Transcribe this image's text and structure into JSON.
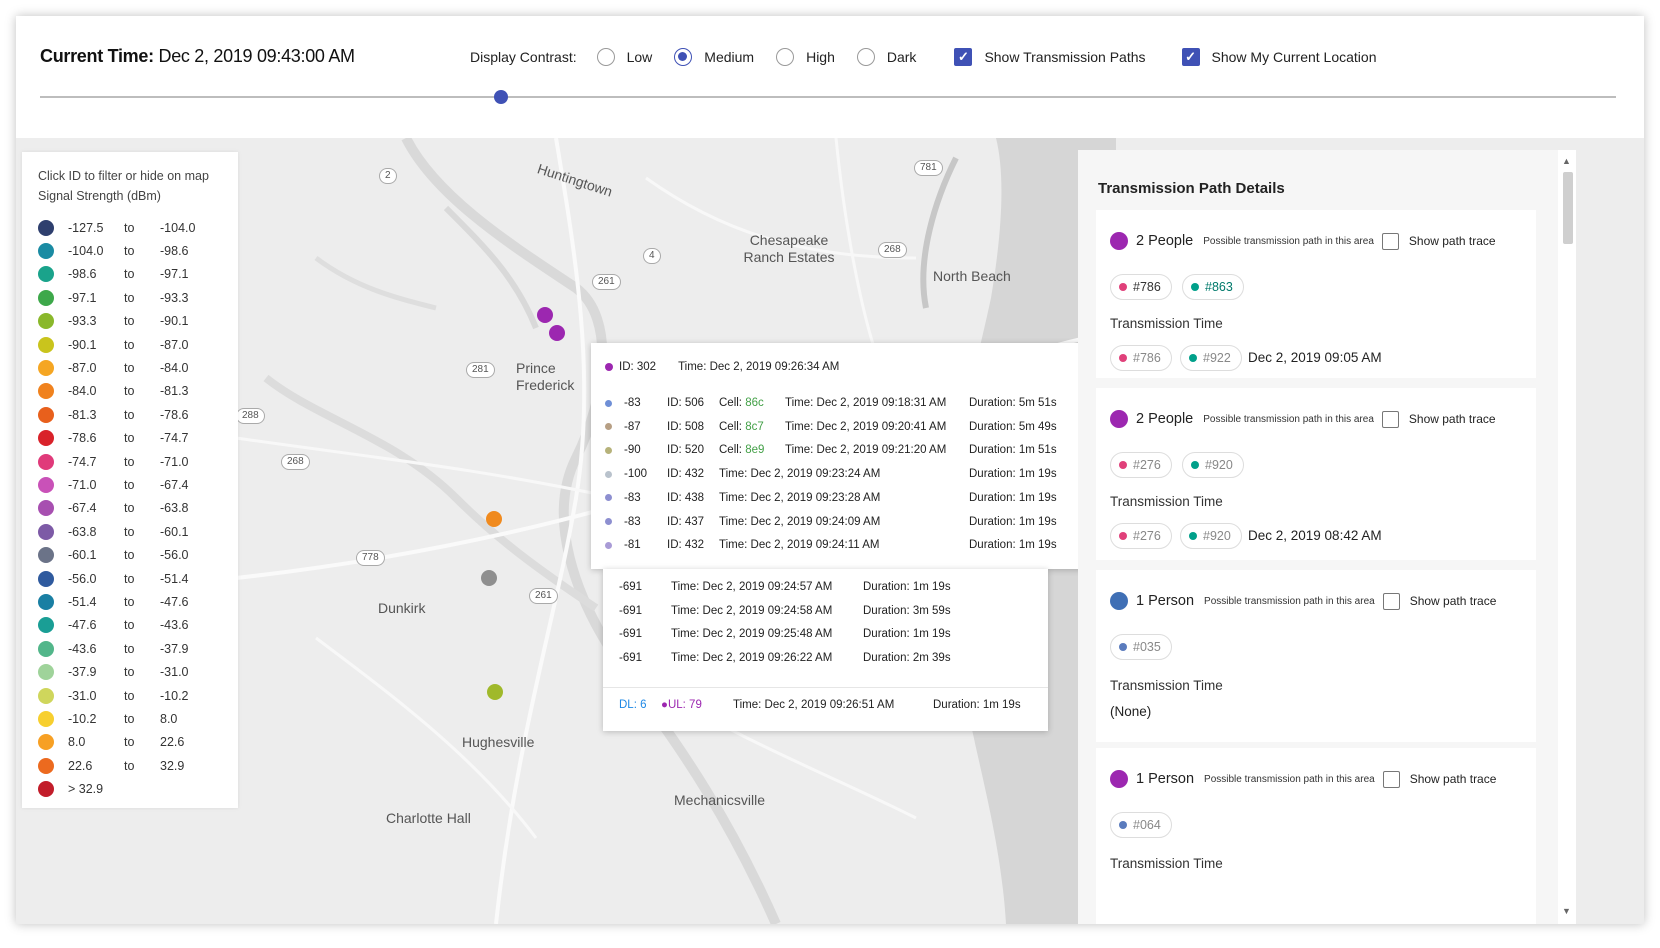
{
  "header": {
    "current_time_label": "Current Time:",
    "current_time_value": "Dec 2, 2019 09:43:00 AM",
    "contrast_label": "Display Contrast:",
    "contrast_options": [
      "Low",
      "Medium",
      "High",
      "Dark"
    ],
    "contrast_selected": "Medium",
    "show_paths_label": "Show Transmission Paths",
    "show_location_label": "Show My Current Location"
  },
  "map": {
    "places": [
      "Huntingtown",
      "Chesapeake Ranch Estates",
      "North Beach",
      "Prince Frederick",
      "Dunkirk",
      "Hughesville",
      "Charlotte Hall",
      "Mechanicsville"
    ],
    "shields": [
      "2",
      "781",
      "4",
      "268",
      "261",
      "281",
      "288",
      "268",
      "778",
      "261"
    ]
  },
  "legend": {
    "hint": "Click ID to filter or hide on map",
    "unit": "Signal Strength (dBm)",
    "to_word": "to",
    "rows": [
      {
        "from": "-127.5",
        "to": "-104.0",
        "color": "#2e3f6e"
      },
      {
        "from": "-104.0",
        "to": "-98.6",
        "color": "#1a8ba3"
      },
      {
        "from": "-98.6",
        "to": "-97.1",
        "color": "#1aa38b"
      },
      {
        "from": "-97.1",
        "to": "-93.3",
        "color": "#3da84a"
      },
      {
        "from": "-93.3",
        "to": "-90.1",
        "color": "#8ab82b"
      },
      {
        "from": "-90.1",
        "to": "-87.0",
        "color": "#c9c41d"
      },
      {
        "from": "-87.0",
        "to": "-84.0",
        "color": "#f5a623"
      },
      {
        "from": "-84.0",
        "to": "-81.3",
        "color": "#f0821e"
      },
      {
        "from": "-81.3",
        "to": "-78.6",
        "color": "#e8601c"
      },
      {
        "from": "-78.6",
        "to": "-74.7",
        "color": "#d9222a"
      },
      {
        "from": "-74.7",
        "to": "-71.0",
        "color": "#e03a7a"
      },
      {
        "from": "-71.0",
        "to": "-67.4",
        "color": "#c951b8"
      },
      {
        "from": "-67.4",
        "to": "-63.8",
        "color": "#a74fb0"
      },
      {
        "from": "-63.8",
        "to": "-60.1",
        "color": "#7d5aa6"
      },
      {
        "from": "-60.1",
        "to": "-56.0",
        "color": "#6b7388"
      },
      {
        "from": "-56.0",
        "to": "-51.4",
        "color": "#2f5a9e"
      },
      {
        "from": "-51.4",
        "to": "-47.6",
        "color": "#1a7fa3"
      },
      {
        "from": "-47.6",
        "to": "-43.6",
        "color": "#1a9e95"
      },
      {
        "from": "-43.6",
        "to": "-37.9",
        "color": "#52b68a"
      },
      {
        "from": "-37.9",
        "to": "-31.0",
        "color": "#9fd39a"
      },
      {
        "from": "-31.0",
        "to": "-10.2",
        "color": "#cfd65c"
      },
      {
        "from": "-10.2",
        "to": "8.0",
        "color": "#f7cf2f"
      },
      {
        "from": "8.0",
        "to": "22.6",
        "color": "#f7a024"
      },
      {
        "from": "22.6",
        "to": "32.9",
        "color": "#ec6a1f"
      },
      {
        "from": "> 32.9",
        "to": "",
        "color": "#c21d2a"
      }
    ]
  },
  "popup": {
    "header_id": "ID: 302",
    "header_time": "Time: Dec 2, 2019 09:26:34 AM",
    "rows": [
      {
        "dbm": "-83",
        "id": "ID: 506",
        "cell_label": "Cell:",
        "cell": "86c",
        "time": "Time: Dec 2, 2019 09:18:31 AM",
        "duration": "Duration: 5m 51s",
        "color": "#6f8fd6"
      },
      {
        "dbm": "-87",
        "id": "ID: 508",
        "cell_label": "Cell:",
        "cell": "8c7",
        "time": "Time: Dec 2, 2019 09:20:41 AM",
        "duration": "Duration: 5m 49s",
        "color": "#b79f84"
      },
      {
        "dbm": "-90",
        "id": "ID: 520",
        "cell_label": "Cell:",
        "cell": "8e9",
        "time": "Time: Dec 2, 2019 09:21:20 AM",
        "duration": "Duration: 1m 51s",
        "color": "#b6b27a"
      },
      {
        "dbm": "-100",
        "id": "ID: 432",
        "cell_label": "",
        "cell": "",
        "time": "Time: Dec 2, 2019 09:23:24 AM",
        "duration": "Duration: 1m 19s",
        "color": "#b9c2cc"
      },
      {
        "dbm": "-83",
        "id": "ID: 438",
        "cell_label": "",
        "cell": "",
        "time": "Time: Dec 2, 2019 09:23:28 AM",
        "duration": "Duration: 1m 19s",
        "color": "#8d8fd0"
      },
      {
        "dbm": "-83",
        "id": "ID: 437",
        "cell_label": "",
        "cell": "",
        "time": "Time: Dec 2, 2019 09:24:09 AM",
        "duration": "Duration: 1m 19s",
        "color": "#8d8fd0"
      },
      {
        "dbm": "-81",
        "id": "ID: 432",
        "cell_label": "",
        "cell": "",
        "time": "Time: Dec 2, 2019 09:24:11 AM",
        "duration": "Duration: 1m 19s",
        "color": "#a99bd6"
      }
    ],
    "rows2": [
      {
        "dbm": "-691",
        "time": "Time: Dec 2, 2019 09:24:57 AM",
        "duration": "Duration: 1m 19s"
      },
      {
        "dbm": "-691",
        "time": "Time: Dec 2, 2019 09:24:58 AM",
        "duration": "Duration: 3m 59s"
      },
      {
        "dbm": "-691",
        "time": "Time: Dec 2, 2019 09:25:48 AM",
        "duration": "Duration: 1m 19s"
      },
      {
        "dbm": "-691",
        "time": "Time: Dec 2, 2019 09:26:22 AM",
        "duration": "Duration: 2m 39s"
      }
    ],
    "footer": {
      "dl": "DL: 6",
      "ul": "UL: 79",
      "time": "Time: Dec 2, 2019 09:26:51 AM",
      "duration": "Duration: 1m 19s"
    }
  },
  "panel": {
    "title": "Transmission Path Details",
    "desc": "Possible transmission path in this area",
    "trace_label": "Show path trace",
    "tt_label": "Transmission Time",
    "cards": [
      {
        "count": "2 People",
        "color": "#9c27b0",
        "ids": [
          "#786",
          "#863"
        ],
        "tt_ids": [
          "#786",
          "#922"
        ],
        "tt": "Dec 2, 2019 09:05 AM"
      },
      {
        "count": "2 People",
        "color": "#9c27b0",
        "ids": [
          "#276",
          "#920"
        ],
        "tt_ids": [
          "#276",
          "#920"
        ],
        "tt": "Dec 2, 2019 08:42 AM"
      },
      {
        "count": "1 Person",
        "color": "#3f6fb5",
        "ids": [
          "#035"
        ],
        "tt_ids": [],
        "tt": "(None)"
      },
      {
        "count": "1 Person",
        "color": "#9c27b0",
        "ids": [
          "#064"
        ],
        "tt_ids": [],
        "tt": ""
      }
    ]
  },
  "colors": {
    "accent": "#3f51b5",
    "pink": "#e0407a",
    "teal": "#00a08a",
    "slate": "#5a7bbd"
  }
}
